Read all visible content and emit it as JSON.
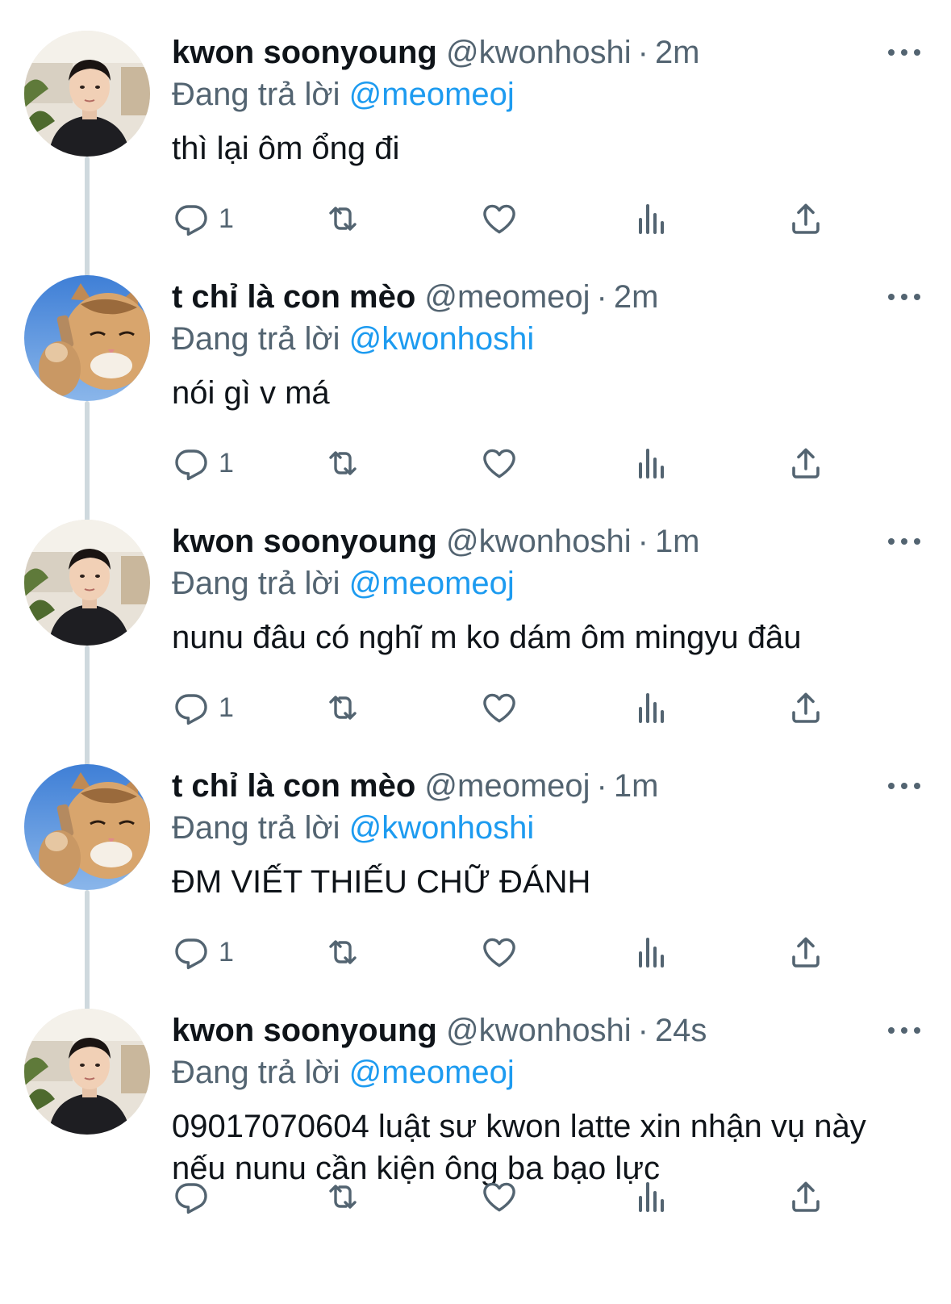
{
  "colors": {
    "text": "#0f1419",
    "secondary": "#536471",
    "link": "#1d9bf0",
    "thread_line": "#cfd9de"
  },
  "tweets": [
    {
      "name": "kwon soonyoung",
      "handle": "@kwonhoshi",
      "dot": "·",
      "time": "2m",
      "replying_prefix": "Đang trả lời",
      "replying_to": "@meomeoj",
      "text": "thì lại ôm ổng đi",
      "reply_count": "1",
      "avatar": "person-avatar"
    },
    {
      "name": "t chỉ là con mèo",
      "handle": "@meomeoj",
      "dot": "·",
      "time": "2m",
      "replying_prefix": "Đang trả lời",
      "replying_to": "@kwonhoshi",
      "text": "nói gì v má",
      "reply_count": "1",
      "avatar": "cat-avatar"
    },
    {
      "name": "kwon soonyoung",
      "handle": "@kwonhoshi",
      "dot": "·",
      "time": "1m",
      "replying_prefix": "Đang trả lời",
      "replying_to": "@meomeoj",
      "text": "nunu đâu có nghĩ m ko dám ôm mingyu đâu",
      "reply_count": "1",
      "avatar": "person-avatar"
    },
    {
      "name": "t chỉ là con mèo",
      "handle": "@meomeoj",
      "dot": "·",
      "time": "1m",
      "replying_prefix": "Đang trả lời",
      "replying_to": "@kwonhoshi",
      "text": "ĐM VIẾT THIẾU CHỮ ĐÁNH",
      "reply_count": "1",
      "avatar": "cat-avatar"
    },
    {
      "name": "kwon soonyoung",
      "handle": "@kwonhoshi",
      "dot": "·",
      "time": "24s",
      "replying_prefix": "Đang trả lời",
      "replying_to": "@meomeoj",
      "text": "09017070604 luật sư kwon latte xin nhận vụ này nếu nunu cần kiện ông ba bạo lực",
      "reply_count": "",
      "avatar": "person-avatar"
    }
  ]
}
